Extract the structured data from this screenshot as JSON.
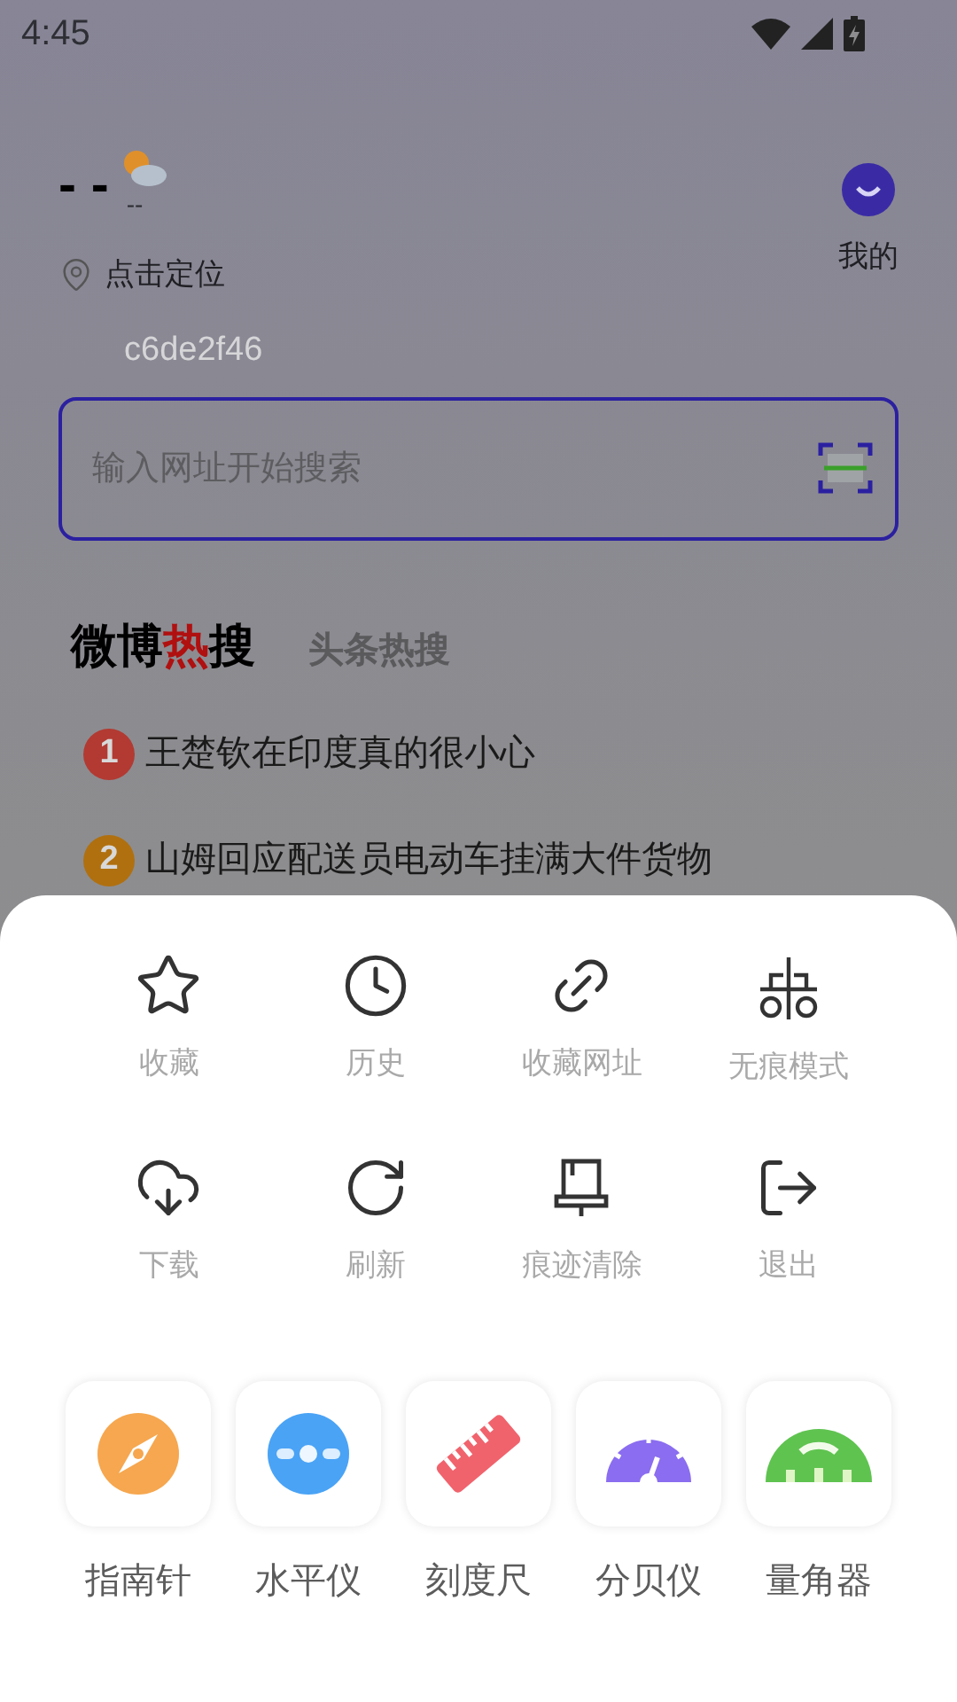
{
  "status_bar": {
    "time": "4:45"
  },
  "weather": {
    "temperature": "- -",
    "condition": "--"
  },
  "profile": {
    "label": "我的"
  },
  "location": {
    "label": "点击定位"
  },
  "device_code": "c6de2f46",
  "search": {
    "placeholder": "输入网址开始搜索"
  },
  "hot_tabs": [
    {
      "label_before": "微博",
      "label_accent": "热",
      "label_after": "搜",
      "selected": true
    },
    {
      "label_before": "头条热搜",
      "selected": false
    }
  ],
  "hot_list": [
    {
      "rank": "1",
      "title": "王楚钦在印度真的很小心",
      "color": "#b23a32"
    },
    {
      "rank": "2",
      "title": "山姆回应配送员电动车挂满大件货物",
      "color": "#b0700f"
    }
  ],
  "menu": [
    {
      "kind": "star",
      "label": "收藏"
    },
    {
      "kind": "clock",
      "label": "历史"
    },
    {
      "kind": "link",
      "label": "收藏网址"
    },
    {
      "kind": "incognito",
      "label": "无痕模式"
    },
    {
      "kind": "download",
      "label": "下载"
    },
    {
      "kind": "refresh",
      "label": "刷新"
    },
    {
      "kind": "brush",
      "label": "痕迹清除"
    },
    {
      "kind": "exit",
      "label": "退出"
    }
  ],
  "tools": [
    {
      "kind": "compass",
      "label": "指南针"
    },
    {
      "kind": "level",
      "label": "水平仪"
    },
    {
      "kind": "ruler",
      "label": "刻度尺"
    },
    {
      "kind": "decibel",
      "label": "分贝仪"
    },
    {
      "kind": "protractor",
      "label": "量角器"
    }
  ]
}
